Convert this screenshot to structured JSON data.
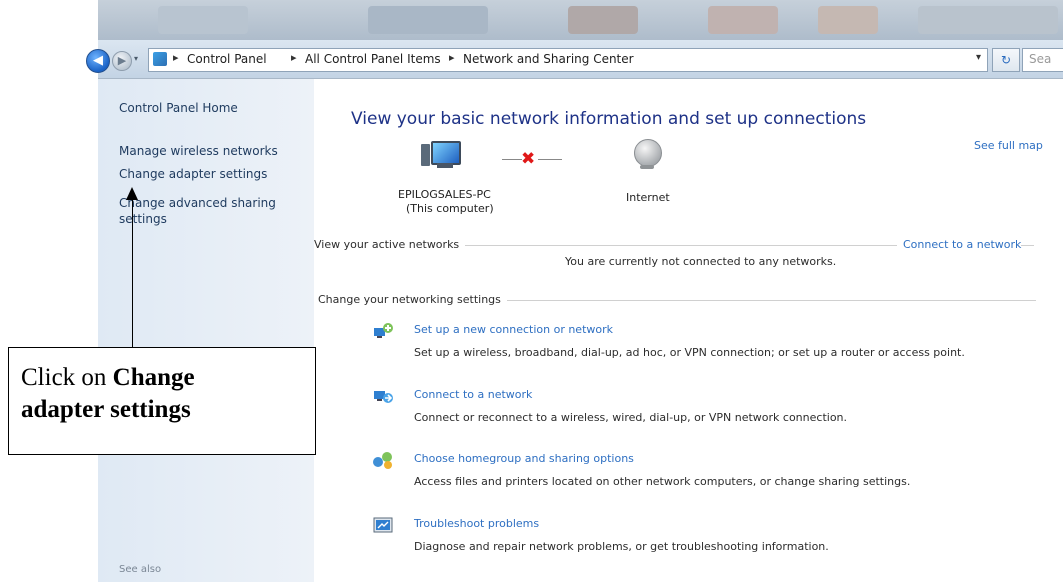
{
  "window": {
    "back_glyph": "◀",
    "forward_glyph": "▶",
    "history_glyph": "▾"
  },
  "address_bar": {
    "crumbs": [
      "Control Panel",
      "All Control Panel Items",
      "Network and Sharing Center"
    ],
    "separator": "▸",
    "dropdown_glyph": "▾",
    "refresh_glyph": "↻",
    "search_placeholder": "Sea"
  },
  "left_pane": {
    "items": [
      {
        "label": "Control Panel Home"
      },
      {
        "label": "Manage wireless networks"
      },
      {
        "label": "Change adapter settings"
      },
      {
        "label": "Change advanced sharing"
      },
      {
        "label": "settings"
      }
    ],
    "see_also": "See also"
  },
  "main": {
    "title": "View your basic network information and set up connections",
    "see_full_map": "See full map",
    "computer_name": "EPILOGSALES-PC",
    "computer_sub": "(This computer)",
    "internet_label": "Internet",
    "link_status_glyph": "✖",
    "active_networks_heading": "View your active networks",
    "connect_to_network_link": "Connect to a network",
    "not_connected_text": "You are currently not connected to any networks.",
    "change_settings_heading": "Change your networking settings",
    "tasks": [
      {
        "link": "Set up a new connection or network",
        "desc": "Set up a wireless, broadband, dial-up, ad hoc, or VPN connection; or set up a router or access point.",
        "icon": "new-connection-icon"
      },
      {
        "link": "Connect to a network",
        "desc": "Connect or reconnect to a wireless, wired, dial-up, or VPN network connection.",
        "icon": "connect-network-icon"
      },
      {
        "link": "Choose homegroup and sharing options",
        "desc": "Access files and printers located on other network computers, or change sharing settings.",
        "icon": "homegroup-icon"
      },
      {
        "link": "Troubleshoot problems",
        "desc": "Diagnose and repair network problems, or get troubleshooting information.",
        "icon": "troubleshoot-icon"
      }
    ]
  },
  "callout": {
    "prefix": "Click on ",
    "bold_first": "Change",
    "bold_second": "adapter settings"
  },
  "colors": {
    "link": "#2e6fc2",
    "title": "#1e3287",
    "status_x": "#e01818"
  }
}
